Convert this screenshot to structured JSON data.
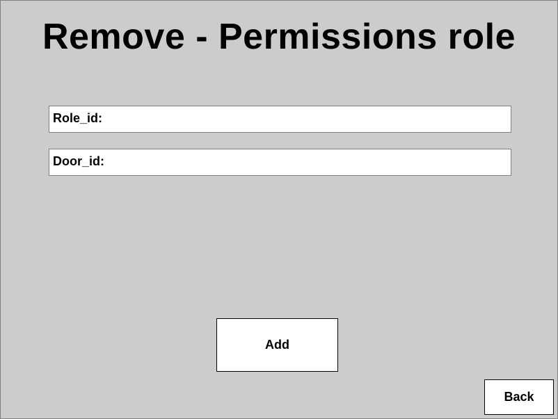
{
  "page": {
    "title": "Remove - Permissions role"
  },
  "form": {
    "role_id": {
      "label": "Role_id:",
      "value": ""
    },
    "door_id": {
      "label": "Door_id:",
      "value": ""
    }
  },
  "actions": {
    "add_label": "Add",
    "back_label": "Back"
  },
  "colors": {
    "background": "#cccccc",
    "field_background": "#ffffff",
    "text": "#000000"
  }
}
